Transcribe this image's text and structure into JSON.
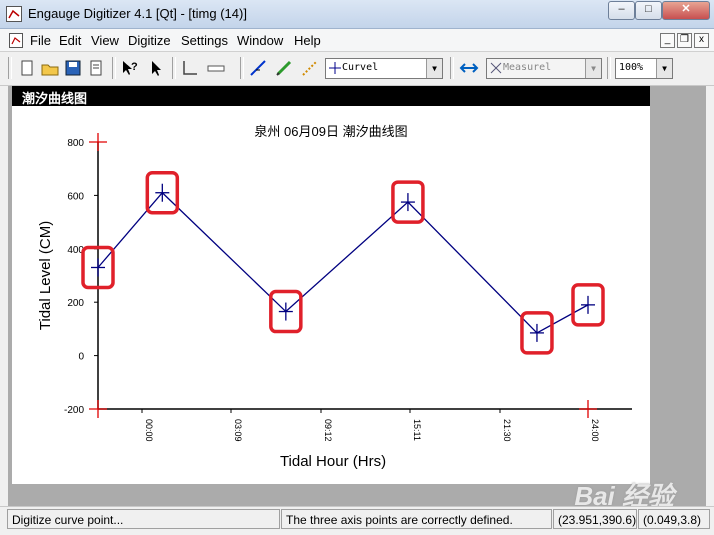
{
  "window": {
    "title": "Engauge Digitizer 4.1 [Qt] - [timg (14)]"
  },
  "menu": {
    "items": [
      "File",
      "Edit",
      "View",
      "Digitize",
      "Settings",
      "Window",
      "Help"
    ]
  },
  "toolbar": {
    "curve_combo": "Curvel",
    "measure_combo": "Measurel",
    "zoom_combo": "100%"
  },
  "document": {
    "title": "潮汐曲线图"
  },
  "chart_data": {
    "type": "line",
    "title": "泉州 06月09日 潮汐曲线图",
    "xlabel": "Tidal Hour (Hrs)",
    "ylabel": "Tidal Level (CM)",
    "categories": [
      "00:00",
      "03:09",
      "09:12",
      "15:11",
      "21:30",
      "24:00"
    ],
    "y_ticks": [
      "800",
      "600",
      "400",
      "200",
      "0",
      "-200"
    ],
    "ylim": [
      -200,
      800
    ],
    "points": [
      {
        "x": 0.0,
        "y": 330
      },
      {
        "x": 3.15,
        "y": 610
      },
      {
        "x": 9.2,
        "y": 165
      },
      {
        "x": 15.18,
        "y": 575
      },
      {
        "x": 21.5,
        "y": 85
      },
      {
        "x": 24.0,
        "y": 190
      }
    ],
    "line_color": "#000080",
    "highlight_color": "#e0202a",
    "axis_marker_color": "#e00000"
  },
  "statusbar": {
    "left": "Digitize curve point...",
    "middle": "The three axis points are correctly defined.",
    "coords1": "(23.951,390.6)",
    "coords2": "(0.049,3.8)"
  },
  "watermark": "Bai 经验"
}
